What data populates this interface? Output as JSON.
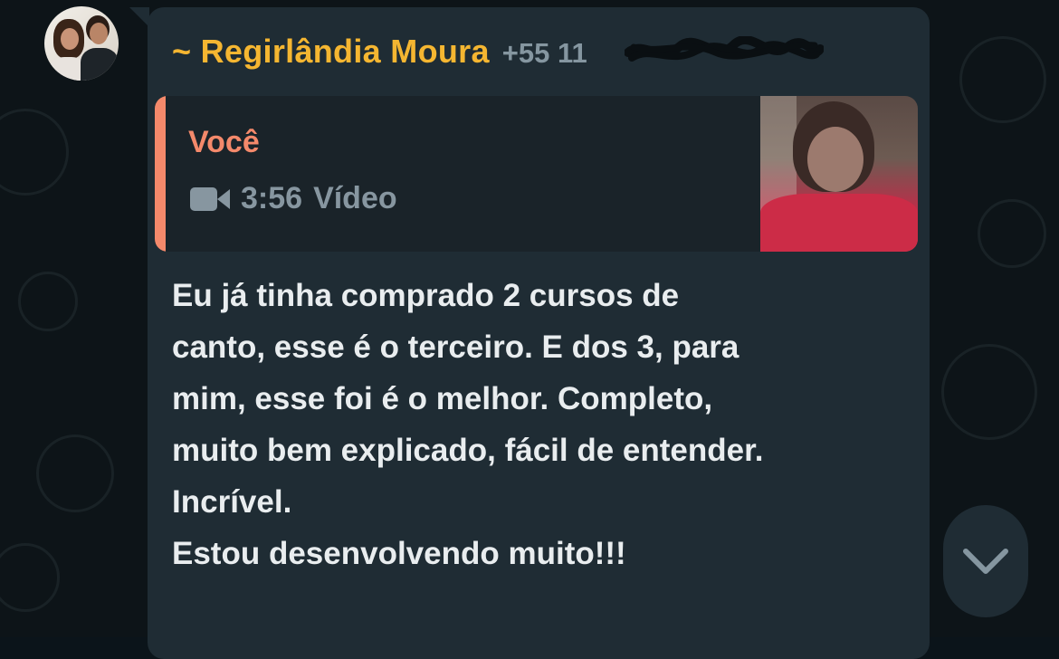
{
  "message": {
    "sender_name": "~ Regirlândia Moura",
    "sender_phone": "+55 11",
    "quoted": {
      "author": "Você",
      "media_icon": "video-camera-icon",
      "duration": "3:56",
      "media_type": "Vídeo"
    },
    "text": "Eu já tinha comprado 2 cursos de\ncanto, esse é o terceiro. E dos 3, para\nmim, esse foi é o melhor. Completo,\nmuito bem explicado, fácil de entender.\nIncrível.\nEstou desenvolvendo muito!!!"
  },
  "scroll_button": {
    "icon": "chevron-down-icon"
  },
  "colors": {
    "background": "#0d1418",
    "bubble": "#1f2c34",
    "sender_name": "#f5b631",
    "quote_accent": "#f4896b",
    "text": "#e9edef",
    "muted": "#8596a0"
  }
}
